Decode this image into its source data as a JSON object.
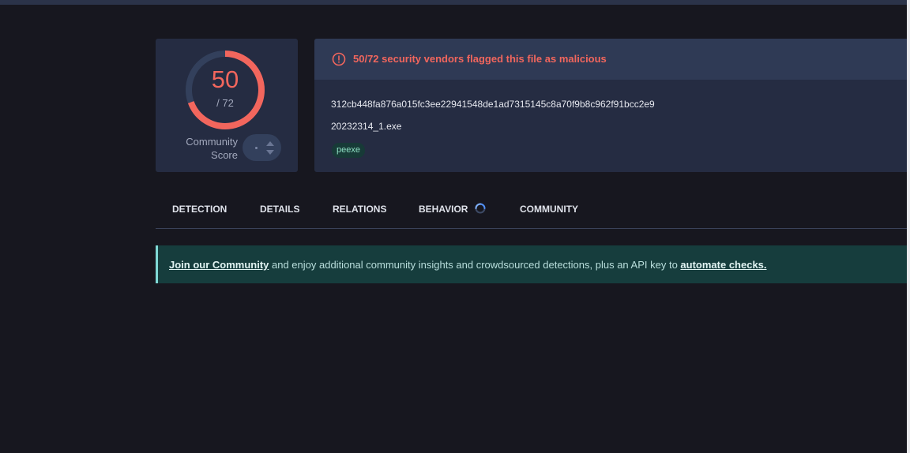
{
  "score": {
    "detections": "50",
    "total": "/ 72",
    "detection_fraction": 0.694,
    "community_label_line1": "Community",
    "community_label_line2": "Score",
    "gauge_color": "#f2665d",
    "gauge_track_color": "#33405c"
  },
  "file": {
    "alert": "50/72 security vendors flagged this file as malicious",
    "alert_icon": "alert-circle-icon",
    "hash": "312cb448fa876a015fc3ee22941548de1ad7315145c8a70f9b8c962f91bcc2e9",
    "name": "20232314_1.exe",
    "tag": "peexe"
  },
  "tabs": {
    "detection": "DETECTION",
    "details": "DETAILS",
    "relations": "RELATIONS",
    "behavior": "BEHAVIOR",
    "community": "COMMUNITY",
    "behavior_icon": "loading-spinner-icon"
  },
  "banner": {
    "join_link": "Join our Community",
    "middle_text": " and enjoy additional community insights and crowdsourced detections, plus an API key to ",
    "automate_link": "automate checks."
  },
  "colors": {
    "background": "#17171f",
    "card": "#252c42",
    "danger": "#f2665d",
    "banner": "#163d3d",
    "accent": "#7fd8d5"
  }
}
